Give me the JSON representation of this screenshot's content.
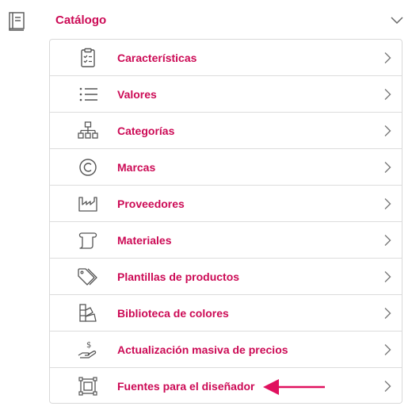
{
  "section": {
    "title": "Catálogo",
    "icon": "book-icon",
    "expanded": true
  },
  "menu": {
    "items": [
      {
        "label": "Características",
        "icon": "clipboard-checklist-icon"
      },
      {
        "label": "Valores",
        "icon": "list-icon"
      },
      {
        "label": "Categorías",
        "icon": "hierarchy-icon"
      },
      {
        "label": "Marcas",
        "icon": "copyright-icon"
      },
      {
        "label": "Proveedores",
        "icon": "factory-icon"
      },
      {
        "label": "Materiales",
        "icon": "scroll-icon"
      },
      {
        "label": "Plantillas de productos",
        "icon": "tags-icon"
      },
      {
        "label": "Biblioteca de colores",
        "icon": "color-swatch-icon"
      },
      {
        "label": "Actualización masiva de precios",
        "icon": "hand-money-icon"
      },
      {
        "label": "Fuentes para el diseñador",
        "icon": "frame-select-icon"
      }
    ]
  },
  "annotation": {
    "icon": "arrow-left-icon",
    "color": "#e0115f"
  },
  "colors": {
    "accent": "#cc0a55",
    "icon": "#555555",
    "border": "#d9d9d9"
  }
}
